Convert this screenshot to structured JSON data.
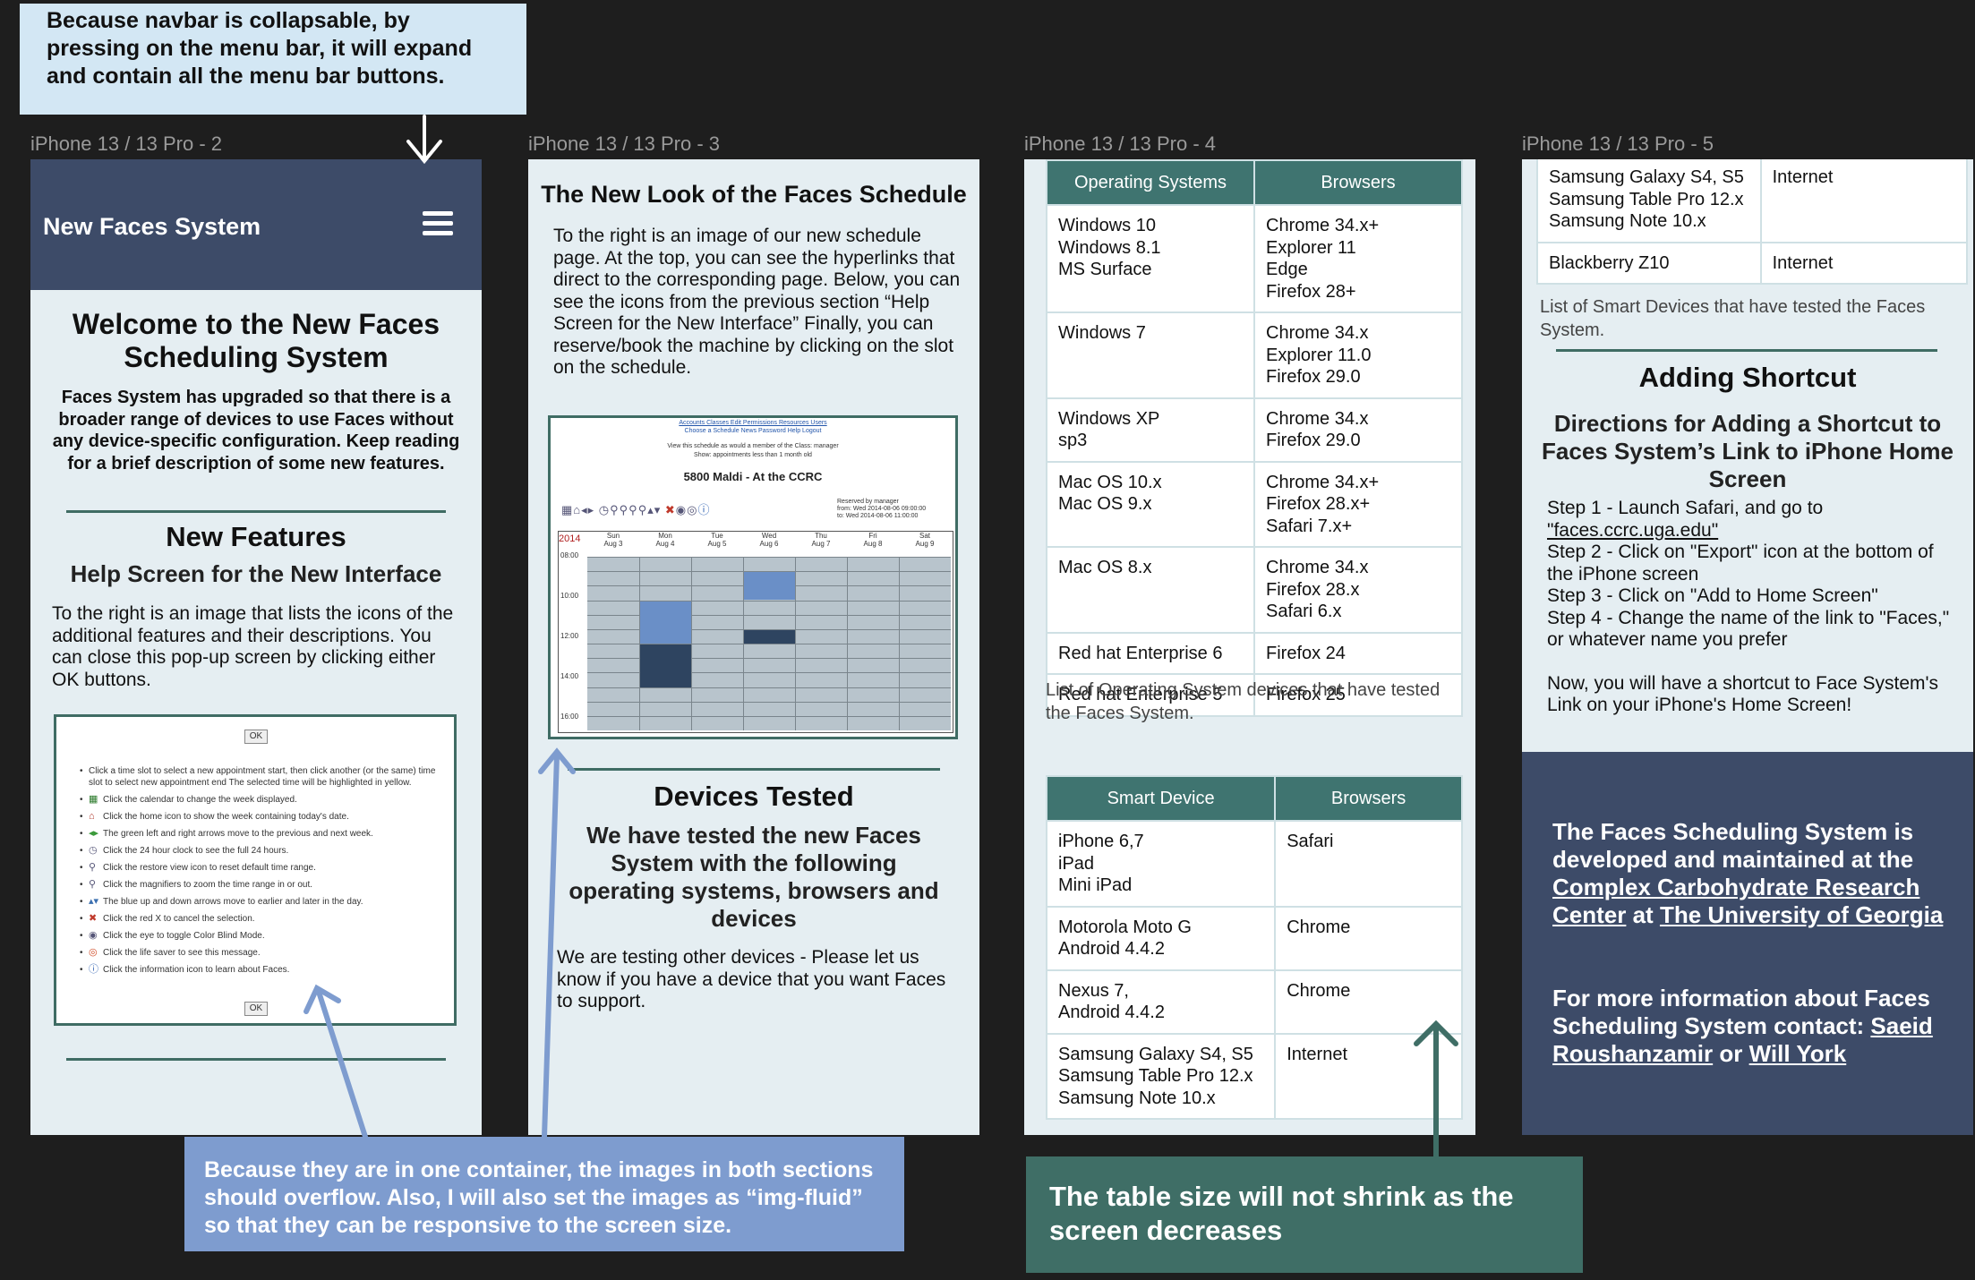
{
  "frames": [
    {
      "label": "iPhone 13 / 13 Pro - 2"
    },
    {
      "label": "iPhone 13 / 13 Pro - 3"
    },
    {
      "label": "iPhone 13 / 13 Pro - 4"
    },
    {
      "label": "iPhone 13 / 13 Pro - 5"
    }
  ],
  "frame1": {
    "brand": "New Faces System",
    "welcome_title": "Welcome to the New Faces Scheduling System",
    "welcome_text": "Faces System has upgraded so that there is a broader range of devices to use Faces without any device-specific configuration. Keep reading for a brief description of some new features.",
    "features_title": "New Features",
    "help_title": "Help Screen for the New Interface",
    "help_text": "To the right is an image that lists the icons of the additional features and their descriptions. You can close this pop-up screen by clicking either OK buttons.",
    "popup": {
      "ok": "OK",
      "items": [
        "Click a time slot to select a new appointment start, then click another (or the same) time slot to select new appointment end The selected time will be highlighted in yellow.",
        "Click the calendar to change the week displayed.",
        "Click the home icon to show the week containing today's date.",
        "The green left and right arrows move to the previous and next week.",
        "Click the 24 hour clock to see the full 24 hours.",
        "Click the restore view icon to reset default time range.",
        "Click the magnifiers to zoom the time range in or out.",
        "The blue up and down arrows move to earlier and later in the day.",
        "Click the red X to cancel the selection.",
        "Click the eye to toggle Color Blind Mode.",
        "Click the life saver to see this message.",
        "Click the information icon to learn about Faces."
      ]
    }
  },
  "frame2": {
    "title": "The New Look of the Faces Schedule",
    "intro": "To the right is an image of our new schedule page. At the top, you can see the hyperlinks that direct to the corresponding page. Below, you can see the icons from the previous section “Help Screen for the New Interface” Finally, you can reserve/book the machine by clicking on the slot on the schedule.",
    "sched": {
      "links": "Accounts  Classes  Edit  Permissions  Resources  Users",
      "links2": "Choose a Schedule  News  Password  Help  Logout",
      "line1": "View this schedule as would a member of the Class: manager",
      "line2": "Show: appointments less than 1 month old",
      "title": "5800 Maldi - At the CCRC",
      "reserved": "Reserved by manager",
      "from": "from: Wed 2014-08-06 09:00:00",
      "to": "to: Wed 2014-08-06 11:00:00",
      "year": "2014",
      "days": [
        {
          "d": "Sun",
          "date": "Aug 3"
        },
        {
          "d": "Mon",
          "date": "Aug 4"
        },
        {
          "d": "Tue",
          "date": "Aug 5"
        },
        {
          "d": "Wed",
          "date": "Aug 6"
        },
        {
          "d": "Thu",
          "date": "Aug 7"
        },
        {
          "d": "Fri",
          "date": "Aug 8"
        },
        {
          "d": "Sat",
          "date": "Aug 9"
        }
      ],
      "times": [
        "08:00",
        "10:00",
        "12:00",
        "14:00",
        "16:00"
      ]
    },
    "devices_title": "Devices Tested",
    "devices_sub": "We have tested the new Faces System with the following operating systems, browsers and devices",
    "devices_text": "We are testing other devices - Please let us know if you have a device that you want Faces to support."
  },
  "frame3": {
    "os_table": {
      "headers": [
        "Operating Systems",
        "Browsers"
      ],
      "rows": [
        [
          "Windows 10\nWindows 8.1\nMS Surface",
          "Chrome 34.x+\nExplorer 11\nEdge\nFirefox 28+"
        ],
        [
          "Windows 7",
          "Chrome 34.x\nExplorer 11.0\nFirefox 29.0"
        ],
        [
          "Windows XP\nsp3",
          "Chrome 34.x\nFirefox 29.0"
        ],
        [
          "Mac OS 10.x\nMac OS 9.x",
          "Chrome 34.x+\nFirefox 28.x+\nSafari 7.x+"
        ],
        [
          "Mac OS 8.x",
          "Chrome 34.x\nFirefox 28.x\nSafari 6.x"
        ],
        [
          "Red hat Enterprise 6",
          "Firefox 24"
        ],
        [
          "Red hat Enterprise 5",
          "Firefox 25"
        ]
      ]
    },
    "os_caption": "List of Operating System devices that have tested the Faces System.",
    "smart_table": {
      "headers": [
        "Smart Device",
        "Browsers"
      ],
      "rows": [
        [
          "iPhone 6,7\niPad\nMini iPad",
          "Safari"
        ],
        [
          "Motorola Moto G\nAndroid 4.4.2",
          "Chrome"
        ],
        [
          "Nexus 7,\nAndroid 4.4.2",
          "Chrome"
        ],
        [
          "Samsung Galaxy S4, S5\nSamsung Table Pro 12.x\nSamsung Note 10.x",
          "Internet"
        ]
      ]
    }
  },
  "frame4": {
    "top_table": {
      "rows": [
        [
          "Samsung Galaxy S4, S5\nSamsung Table Pro 12.x\nSamsung Note 10.x",
          "Internet"
        ],
        [
          "Blackberry Z10",
          "Internet"
        ]
      ]
    },
    "caption": "List of Smart Devices that have tested the Faces System.",
    "shortcut_title": "Adding Shortcut",
    "directions_title": "Directions for Adding a Shortcut to Faces System’s Link to iPhone Home Screen",
    "steps": [
      "Step 1 - Launch Safari, and go to",
      "\"faces.ccrc.uga.edu\"",
      "Step 2 - Click on \"Export\" icon at the bottom of the iPhone screen",
      "Step 3 - Click on \"Add to Home Screen\"",
      "Step 4 - Change the name of the link to \"Faces,\" or whatever name you prefer"
    ],
    "final": "Now, you will have a shortcut to Face System's Link on your iPhone's Home Screen!",
    "footer": {
      "p1_a": "The Faces Scheduling System is developed and maintained at the ",
      "p1_link1": "Complex Carbohydrate Research Center",
      "p1_b": " at ",
      "p1_link2": "The University of Georgia",
      "p2_a": "For more information about Faces Scheduling System contact: ",
      "p2_link1": "Saeid Roushanzamir",
      "p2_b": " or ",
      "p2_link2": "Will York"
    }
  },
  "notes": {
    "navbar": "Because navbar is collapsable, by pressing on the menu bar, it will expand and contain all the menu bar buttons.",
    "images": "Because they are in one container, the images in both sections should overflow. Also, I will also set the images as “img-fluid” so that they can be responsive to the screen size.",
    "table": "The table size will not shrink as the screen decreases"
  },
  "colors": {
    "canvas": "#1e1e1e",
    "navbar": "#3d4b68",
    "teal": "#3f7470",
    "page_bg": "#e5eef2",
    "note_blue": "#7e9ccf",
    "note_light": "#d3e7f4",
    "note_teal": "#3f6e66"
  }
}
